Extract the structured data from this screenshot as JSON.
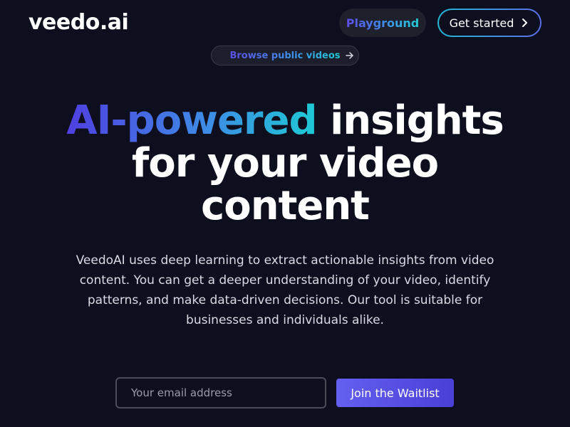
{
  "header": {
    "brand": "veedo.ai",
    "nav": {
      "playground_label": "Playground",
      "get_started_label": "Get started"
    }
  },
  "announcement": {
    "label": "Browse public videos"
  },
  "hero": {
    "headline_gradient": "AI-powered",
    "headline_rest_line1": " insights",
    "headline_line2": "for your video",
    "headline_line3": "content",
    "subtitle": "VeedoAI uses deep learning to extract actionable insights from video content. You can get a deeper understanding of your video, identify patterns, and make data-driven decisions. Our tool is suitable for businesses and individuals alike."
  },
  "waitlist": {
    "email_placeholder": "Your email address",
    "email_value": "",
    "button_label": "Join the Waitlist"
  },
  "icons": {
    "get_started": "chevron-right-icon",
    "announcement": "arrow-right-icon"
  },
  "colors": {
    "background": "#0d0f1e",
    "gradient_start": "#4f3fe0",
    "gradient_mid": "#3f8ae6",
    "gradient_end": "#1ecad4",
    "button_accent": "#5b55ea"
  }
}
